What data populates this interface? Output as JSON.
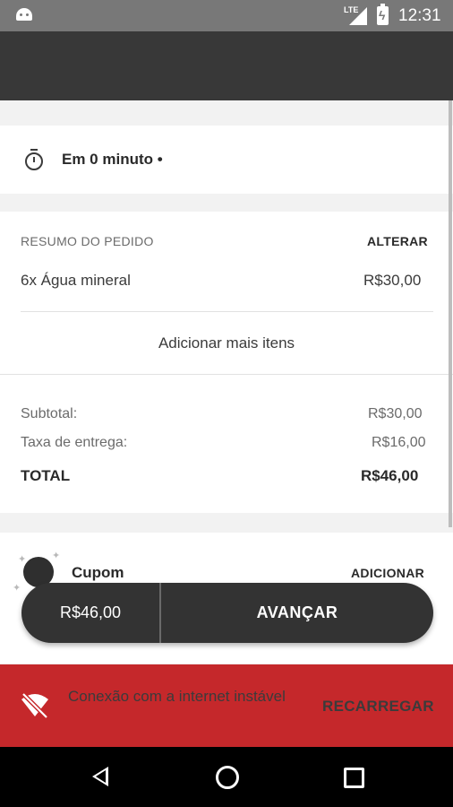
{
  "status_bar": {
    "network": "LTE",
    "time": "12:31"
  },
  "eta": {
    "text": "Em 0 minuto •"
  },
  "summary": {
    "heading": "RESUMO DO PEDIDO",
    "change_label": "ALTERAR",
    "items": [
      {
        "description": "6x Água mineral",
        "price": "R$30,00"
      }
    ],
    "add_more_label": "Adicionar mais itens",
    "subtotal_label": "Subtotal:",
    "subtotal_value": "R$30,00",
    "delivery_label": "Taxa de entrega:",
    "delivery_value": "R$16,00",
    "total_label": "TOTAL",
    "total_value": "R$46,00"
  },
  "coupon": {
    "label": "Cupom",
    "add_label": "ADICIONAR"
  },
  "checkout": {
    "price": "R$46,00",
    "next_label": "AVANÇAR"
  },
  "banner": {
    "message": "Conexão com a internet instável",
    "action_label": "RECARREGAR",
    "color": "#c5282b"
  },
  "icons": [
    "stopwatch-icon",
    "wifi-off-icon",
    "nav-back-icon",
    "nav-home-icon",
    "nav-recent-icon"
  ]
}
